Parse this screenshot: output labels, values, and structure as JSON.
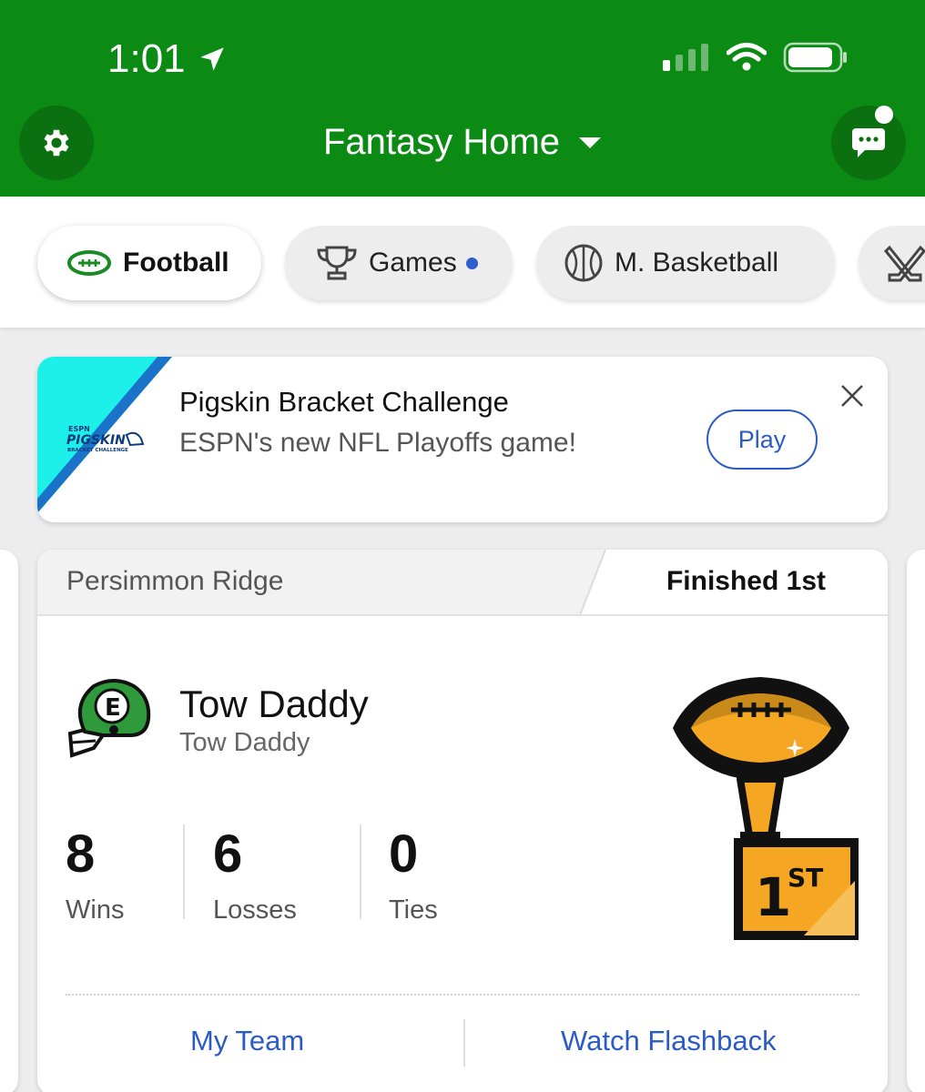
{
  "status_bar": {
    "time": "1:01"
  },
  "header": {
    "title": "Fantasy Home"
  },
  "tabs": [
    {
      "label": "Football",
      "icon": "football-icon",
      "active": true
    },
    {
      "label": "Games",
      "icon": "trophy-icon",
      "badge": true
    },
    {
      "label": "M. Basketball",
      "icon": "basketball-icon"
    },
    {
      "label": "",
      "icon": "hockey-sticks-icon"
    }
  ],
  "promo": {
    "title": "Pigskin Bracket Challenge",
    "subtitle": "ESPN's new NFL Playoffs game!",
    "button_label": "Play",
    "logo_text": "ESPN PIGSKIN BRACKET CHALLENGE"
  },
  "league_card": {
    "league_name": "Persimmon Ridge",
    "finish": "Finished 1st",
    "team_name": "Tow Daddy",
    "owner_name": "Tow Daddy",
    "stats": [
      {
        "value": "8",
        "label": "Wins"
      },
      {
        "value": "6",
        "label": "Losses"
      },
      {
        "value": "0",
        "label": "Ties"
      }
    ],
    "trophy_place": "1ST",
    "links": {
      "my_team": "My Team",
      "flashback": "Watch Flashback"
    }
  },
  "colors": {
    "header_green": "#0b8a14",
    "link_blue": "#2b5cc4",
    "trophy_gold": "#f5a623"
  }
}
